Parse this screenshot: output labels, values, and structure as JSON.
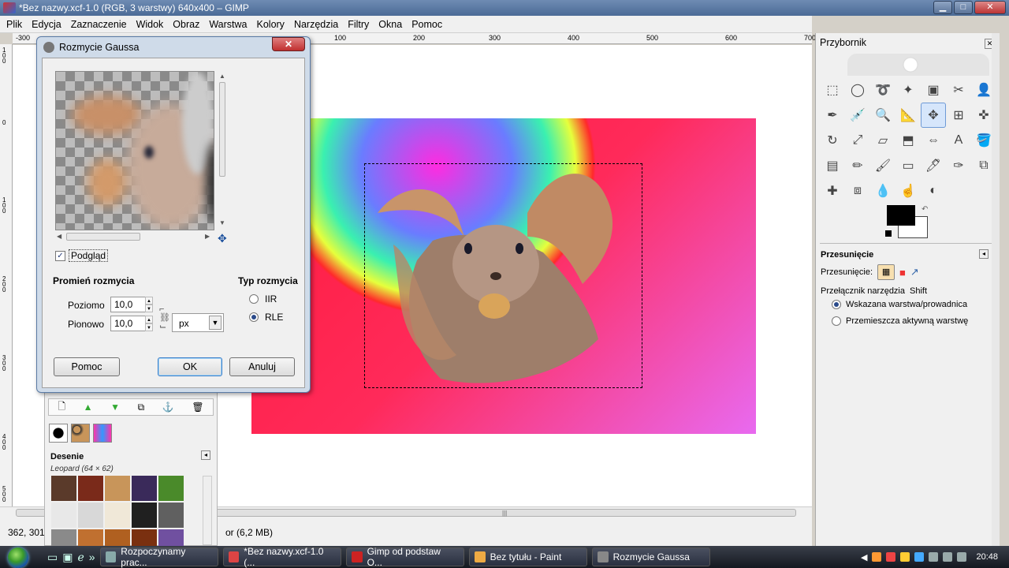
{
  "window": {
    "title": "*Bez nazwy.xcf-1.0 (RGB, 3 warstwy) 640x400 – GIMP",
    "min": "▁",
    "max": "□",
    "close": "✕"
  },
  "menu": [
    "Plik",
    "Edycja",
    "Zaznaczenie",
    "Widok",
    "Obraz",
    "Warstwa",
    "Kolory",
    "Narzędzia",
    "Filtry",
    "Okna",
    "Pomoc"
  ],
  "ruler": {
    "h": [
      "-300",
      "100",
      "200",
      "300",
      "400",
      "500",
      "600",
      "700"
    ],
    "v": [
      "100",
      "0",
      "100",
      "200",
      "300",
      "400",
      "500"
    ]
  },
  "status": {
    "coords": "362, 301",
    "info": "or (6,2 MB)"
  },
  "layers_panel": {
    "toolbar_icons": [
      "new-layer-icon",
      "raise-icon",
      "lower-icon",
      "duplicate-icon",
      "anchor-icon",
      "delete-icon"
    ],
    "patterns_title": "Desenie",
    "patterns_selected": "Leopard (64 × 62)",
    "pattern_colors": [
      "#5a3a2a",
      "#7a2a1a",
      "#c8955a",
      "#3a2a5a",
      "#4a8a2a",
      "#e8e8e8",
      "#d8d8d8",
      "#f0e8d8",
      "#202020",
      "#606060",
      "#8a8a8a",
      "#c07030",
      "#b06020",
      "#7a3010",
      "#7050a0"
    ]
  },
  "dialog": {
    "title": "Rozmycie Gaussa",
    "close": "✕",
    "preview_label": "Podgląd",
    "preview_checked": "✓",
    "radius_title": "Promień rozmycia",
    "horizontal_label": "Poziomo",
    "horizontal_value": "10,0",
    "vertical_label": "Pionowo",
    "vertical_value": "10,0",
    "unit": "px",
    "type_title": "Typ rozmycia",
    "type_options": [
      "IIR",
      "RLE"
    ],
    "type_selected": "RLE",
    "help": "Pomoc",
    "ok": "OK",
    "cancel": "Anuluj"
  },
  "toolbox": {
    "title": "Przybornik",
    "tools": [
      "rect-select",
      "ellipse-select",
      "free-select",
      "fuzzy-select",
      "color-select",
      "scissors",
      "foreground-select",
      "paths",
      "color-picker",
      "zoom",
      "measure",
      "move",
      "align",
      "crop",
      "rotate",
      "scale",
      "shear",
      "perspective",
      "flip",
      "text",
      "bucket-fill",
      "blend",
      "pencil",
      "paintbrush",
      "eraser",
      "airbrush",
      "ink",
      "clone",
      "heal",
      "perspective-clone",
      "blur",
      "smudge",
      "dodge-burn"
    ],
    "tool_glyphs": [
      "⬚",
      "◯",
      "➰",
      "✦",
      "▣",
      "✂",
      "👤",
      "✒",
      "💉",
      "🔍",
      "📐",
      "✥",
      "⊞",
      "✜",
      "↻",
      "⤢",
      "▱",
      "⬒",
      "⇔",
      "A",
      "🪣",
      "▤",
      "✏",
      "🖌",
      "▭",
      "🖊",
      "✑",
      "⧉",
      "✚",
      "⧈",
      "💧",
      "☝",
      "◐"
    ],
    "active_tool": "move",
    "options_title": "Przesunięcie",
    "mode_label": "Przesunięcie:",
    "switch_label": "Przełącznik narzędzia",
    "switch_key": "Shift",
    "option1": "Wskazana warstwa/prowadnica",
    "option2": "Przemieszcza aktywną warstwę",
    "fg_color": "#000000",
    "bg_color": "#ffffff"
  },
  "taskbar": {
    "tasks": [
      {
        "label": "Rozpoczynamy prac...",
        "color": "#8aa"
      },
      {
        "label": "*Bez nazwy.xcf-1.0 (...",
        "color": "#d44"
      },
      {
        "label": "Gimp od podstaw O...",
        "color": "#c22"
      },
      {
        "label": "Bez tytułu - Paint",
        "color": "#ea4"
      },
      {
        "label": "Rozmycie Gaussa",
        "color": "#888"
      }
    ],
    "time": "20:48"
  }
}
